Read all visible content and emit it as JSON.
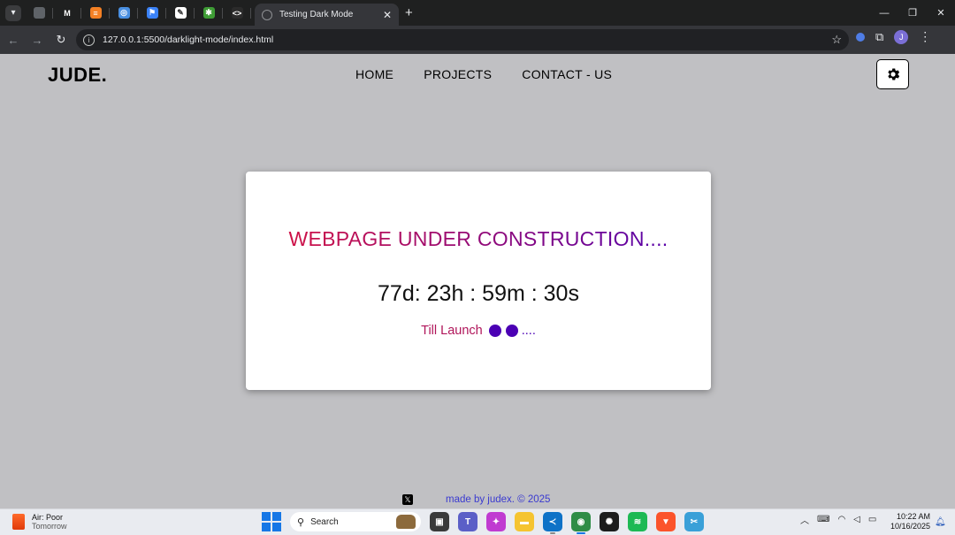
{
  "browser": {
    "active_tab_title": "Testing Dark Mode",
    "url": "127.0.0.1:5500/darklight-mode/index.html",
    "profile_initial": "J",
    "pinned_tabs": [
      {
        "icon": "globe-icon",
        "glyph": "",
        "color": "#5f6368"
      },
      {
        "icon": "medium-icon",
        "glyph": "M",
        "color": "#1f2020"
      },
      {
        "icon": "stackoverflow-icon",
        "glyph": "≡",
        "color": "#f48024"
      },
      {
        "icon": "spiral-icon",
        "glyph": "◎",
        "color": "#4a90e2"
      },
      {
        "icon": "flag-icon",
        "glyph": "⚑",
        "color": "#3b82f6"
      },
      {
        "icon": "figma-icon",
        "glyph": "✎",
        "color": "#ffffff"
      },
      {
        "icon": "multicolor-icon",
        "glyph": "✱",
        "color": "#3e9c35"
      },
      {
        "icon": "code-icon",
        "glyph": "<>",
        "color": "#2b2b2b"
      }
    ]
  },
  "site": {
    "logo": "JUDE.",
    "nav": [
      "HOME",
      "PROJECTS",
      "CONTACT - US"
    ],
    "headline": "WEBPAGE UNDER CONSTRUCTION....",
    "countdown": "77d: 23h : 59m : 30s",
    "till_label": "Till Launch",
    "till_trail": "....",
    "footer_credit": "made by judex. © 2025"
  },
  "taskbar": {
    "weather_title": "Air: Poor",
    "weather_sub": "Tomorrow",
    "search_placeholder": "Search",
    "time": "10:22 AM",
    "date": "10/16/2025",
    "apps": [
      {
        "name": "file-explorer-dark-icon",
        "glyph": "▣",
        "color": "#3a3a3a"
      },
      {
        "name": "teams-icon",
        "glyph": "T",
        "color": "#5b5fc7"
      },
      {
        "name": "copilot-icon",
        "glyph": "✦",
        "color": "#c03bd1"
      },
      {
        "name": "folder-icon",
        "glyph": "▬",
        "color": "#f5c431"
      },
      {
        "name": "vscode-icon",
        "glyph": "≺",
        "color": "#0e72c7"
      },
      {
        "name": "chrome-icon",
        "glyph": "◉",
        "color": "#2f8d46"
      },
      {
        "name": "chatgpt-icon",
        "glyph": "✺",
        "color": "#1c1c1c"
      },
      {
        "name": "spotify-icon",
        "glyph": "≋",
        "color": "#1db954"
      },
      {
        "name": "brave-icon",
        "glyph": "▼",
        "color": "#fb542b"
      },
      {
        "name": "snipping-tool-icon",
        "glyph": "✂",
        "color": "#3aa0d8"
      }
    ]
  },
  "colors": {
    "gradient_start": "#dc143c",
    "gradient_end": "#4b00b4",
    "page_bg": "#c0c0c3"
  }
}
